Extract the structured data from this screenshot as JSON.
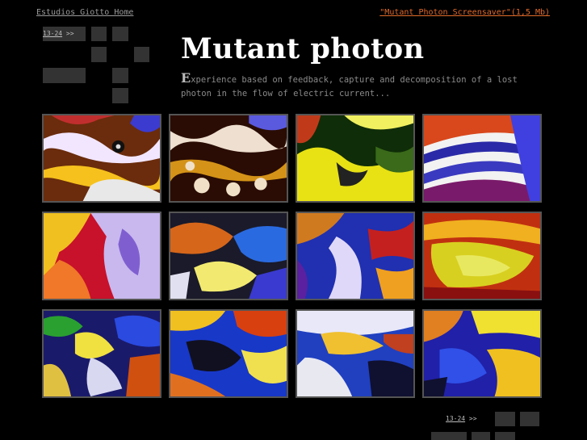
{
  "header": {
    "home_link": "Estudios Giotto Home",
    "download_link": "\"Mutant Photon Screensaver\"(1,5 Mb)"
  },
  "nav": {
    "range_label": "13-24",
    "arrows": ">>"
  },
  "title": "Mutant photon",
  "intro": {
    "first_letter": "E",
    "rest": "xperience based on feedback, capture and decomposition of a lost photon in the flow of electric current..."
  },
  "colors": {
    "background": "#000000",
    "link_accent": "#e06a2a",
    "nav_square": "#333333",
    "thumb_border": "#555555"
  },
  "gallery": {
    "thumbnail_count": 12
  }
}
